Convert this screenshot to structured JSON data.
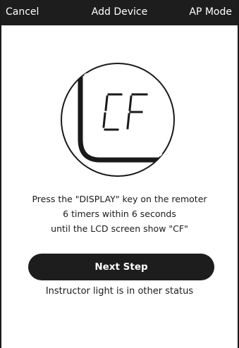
{
  "navbar": {
    "cancel_label": "Cancel",
    "title": "Add Device",
    "mode_label": "AP Mode"
  },
  "illustration": {
    "lcd_text": "CF"
  },
  "instructions": {
    "line1": "Press the \"DISPLAY\" key on the remoter",
    "line2": "6 timers within 6 seconds",
    "line3": "until the LCD screen show \"CF\""
  },
  "next_button": {
    "label": "Next Step"
  },
  "status_link": {
    "label": "Instructor light is in other status"
  },
  "colors": {
    "navbar_bg": "#1d1d1d",
    "button_bg": "#1d1d1d",
    "text": "#1a1a1a",
    "background": "#ffffff"
  }
}
